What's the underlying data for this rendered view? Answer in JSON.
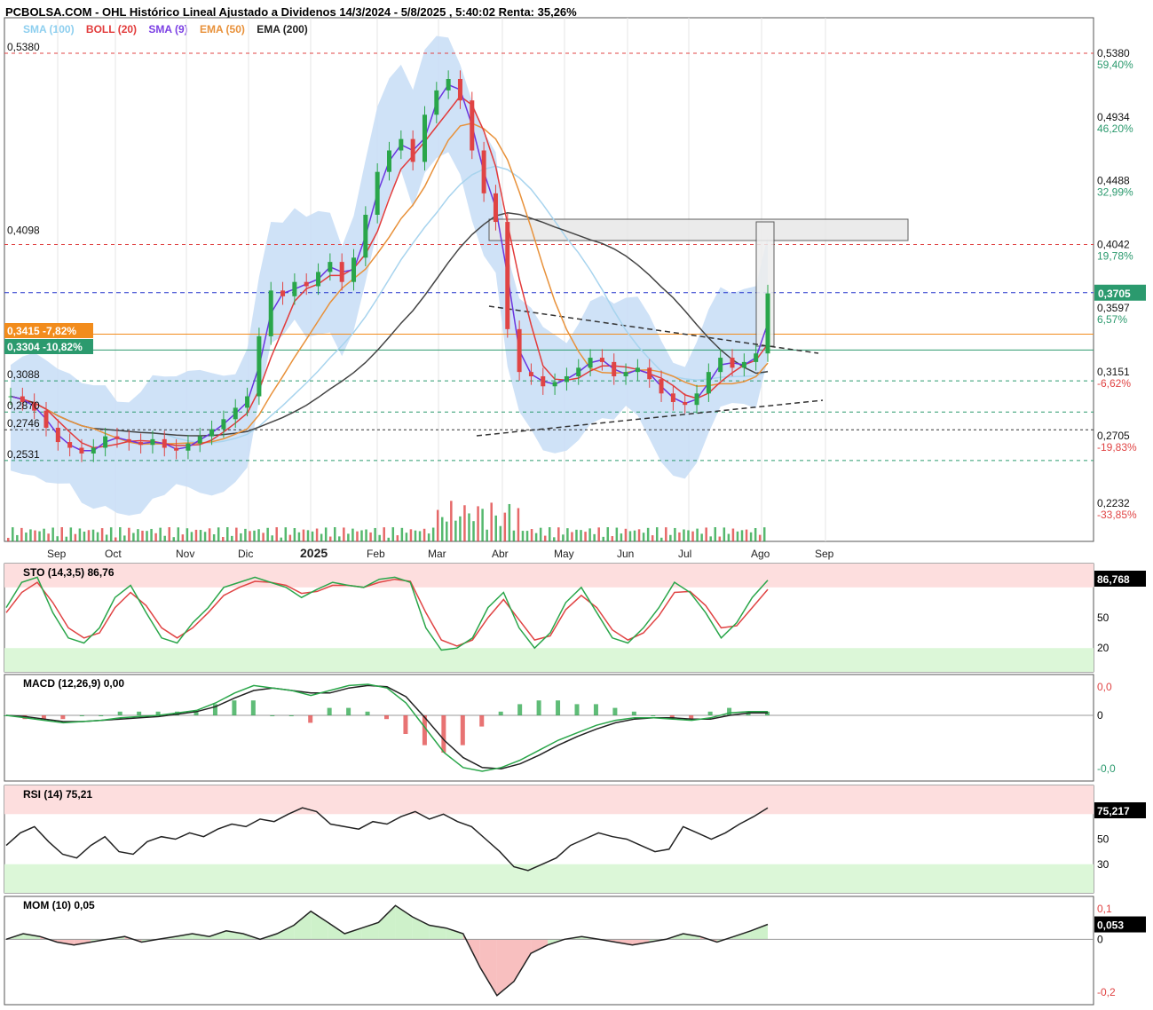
{
  "header": {
    "title": "PCBOLSA.COM - OHL Histórico Lineal Ajustado a Dividenos 14/3/2024 - 5/8/2025 , 5:40:02 Renta: 35,26%",
    "legend": [
      {
        "label": "SMA (100)",
        "color": "#8ecfef"
      },
      {
        "label": "BOLL (20)",
        "color": "#e23b3b"
      },
      {
        "label": "SMA (9)",
        "color": "#7b3fe4"
      },
      {
        "label": "EMA (50)",
        "color": "#e8913a"
      },
      {
        "label": "EMA (200)",
        "color": "#222222"
      }
    ]
  },
  "colors": {
    "up": "#2aa64a",
    "down": "#e04444",
    "boll_band": "#c7ddf6",
    "sma100": "#a8d4ee",
    "boll_mid": "#e23b3b",
    "sma9": "#6a35e0",
    "ema50": "#e8913a",
    "ema200": "#444444",
    "green_line": "#2b9a6e",
    "blue_dash": "#2233cc",
    "red_dash": "#e04444"
  },
  "chart_data": [
    {
      "type": "line",
      "name": "price",
      "x_ticks": [
        "Sep",
        "Oct",
        "Nov",
        "Dic",
        "2025",
        "Feb",
        "Mar",
        "Abr",
        "May",
        "Jun",
        "Jul",
        "Ago",
        "Sep"
      ],
      "right_axis": [
        {
          "value": "0,5380",
          "pct": "59,40%",
          "pct_color": "#2b9a6e"
        },
        {
          "value": "0,4934",
          "pct": "46,20%",
          "pct_color": "#2b9a6e"
        },
        {
          "value": "0,4488",
          "pct": "32,99%",
          "pct_color": "#2b9a6e"
        },
        {
          "value": "0,4042",
          "pct": "19,78%",
          "pct_color": "#2b9a6e"
        },
        {
          "value": "0,3597",
          "pct": "6,57%",
          "pct_color": "#2b9a6e"
        },
        {
          "value": "0,3151",
          "pct": "-6,62%",
          "pct_color": "#e04444"
        },
        {
          "value": "0,2705",
          "pct": "-19,83%",
          "pct_color": "#e04444"
        },
        {
          "value": "0,2232",
          "pct": "-33,85%",
          "pct_color": "#e04444"
        }
      ],
      "left_levels": [
        "0,5380",
        "0,4098",
        "0,3088",
        "0,2870",
        "0,2746",
        "0,2531"
      ],
      "last_price": "0,3705",
      "badges": [
        {
          "text": "0,3415  -7,82%",
          "color": "#f28c1c"
        },
        {
          "text": "0,3304  -10,82%",
          "color": "#2b9a6e"
        }
      ],
      "closes": [
        0.298,
        0.294,
        0.288,
        0.276,
        0.266,
        0.262,
        0.258,
        0.262,
        0.27,
        0.268,
        0.266,
        0.264,
        0.268,
        0.262,
        0.26,
        0.265,
        0.27,
        0.275,
        0.282,
        0.29,
        0.298,
        0.34,
        0.372,
        0.368,
        0.378,
        0.375,
        0.385,
        0.392,
        0.378,
        0.395,
        0.425,
        0.455,
        0.47,
        0.478,
        0.462,
        0.495,
        0.512,
        0.52,
        0.505,
        0.47,
        0.44,
        0.42,
        0.345,
        0.315,
        0.312,
        0.305,
        0.308,
        0.312,
        0.318,
        0.325,
        0.322,
        0.312,
        0.315,
        0.318,
        0.31,
        0.3,
        0.294,
        0.292,
        0.3,
        0.315,
        0.325,
        0.318,
        0.322,
        0.328,
        0.37
      ]
    },
    {
      "type": "line",
      "name": "STO (14,3,5)",
      "label": "STO (14,3,5)",
      "value": "86,76",
      "badge": "86,768",
      "ticks": [
        "50",
        "20"
      ],
      "levels": [
        20,
        80
      ],
      "k": [
        60,
        85,
        90,
        55,
        30,
        25,
        40,
        70,
        82,
        55,
        30,
        25,
        45,
        60,
        80,
        85,
        90,
        85,
        80,
        70,
        78,
        85,
        82,
        80,
        88,
        90,
        85,
        40,
        18,
        20,
        30,
        60,
        75,
        40,
        20,
        35,
        65,
        80,
        55,
        30,
        25,
        40,
        60,
        85,
        75,
        55,
        30,
        45,
        70,
        87
      ],
      "d": [
        55,
        75,
        85,
        65,
        40,
        30,
        35,
        60,
        75,
        62,
        40,
        30,
        40,
        55,
        72,
        80,
        86,
        85,
        82,
        74,
        76,
        82,
        82,
        80,
        85,
        88,
        86,
        55,
        28,
        22,
        28,
        50,
        68,
        48,
        28,
        32,
        58,
        72,
        60,
        38,
        28,
        35,
        52,
        75,
        76,
        62,
        40,
        42,
        60,
        78
      ]
    },
    {
      "type": "line",
      "name": "MACD (12,26,9)",
      "label": "MACD (12,26,9)",
      "value": "0,00",
      "ticks": [
        "0,0",
        "0",
        "-0,0"
      ],
      "macd": [
        0.0,
        -0.002,
        -0.004,
        -0.006,
        -0.005,
        -0.004,
        -0.002,
        -0.001,
        0.0,
        0.002,
        0.004,
        0.01,
        0.018,
        0.024,
        0.022,
        0.02,
        0.016,
        0.02,
        0.024,
        0.025,
        0.022,
        0.01,
        -0.01,
        -0.03,
        -0.042,
        -0.045,
        -0.042,
        -0.036,
        -0.028,
        -0.02,
        -0.014,
        -0.008,
        -0.004,
        -0.002,
        -0.002,
        -0.003,
        -0.004,
        -0.002,
        0.002,
        0.003,
        0.003
      ],
      "signal": [
        0.0,
        -0.001,
        -0.003,
        -0.005,
        -0.005,
        -0.004,
        -0.003,
        -0.002,
        -0.001,
        0.001,
        0.003,
        0.007,
        0.014,
        0.02,
        0.022,
        0.02,
        0.018,
        0.018,
        0.022,
        0.024,
        0.023,
        0.015,
        -0.002,
        -0.02,
        -0.034,
        -0.042,
        -0.043,
        -0.039,
        -0.032,
        -0.024,
        -0.017,
        -0.011,
        -0.006,
        -0.003,
        -0.002,
        -0.002,
        -0.003,
        -0.003,
        0.0,
        0.002,
        0.002
      ]
    },
    {
      "type": "line",
      "name": "RSI (14)",
      "label": "RSI (14)",
      "value": "75,21",
      "badge": "75,217",
      "ticks": [
        "50",
        "30"
      ],
      "levels": [
        30,
        70
      ],
      "values": [
        45,
        55,
        60,
        48,
        38,
        35,
        45,
        52,
        40,
        38,
        48,
        52,
        50,
        55,
        52,
        58,
        62,
        60,
        66,
        64,
        70,
        75,
        72,
        62,
        60,
        58,
        64,
        62,
        68,
        72,
        66,
        70,
        64,
        60,
        50,
        40,
        28,
        25,
        30,
        35,
        45,
        50,
        55,
        52,
        50,
        45,
        40,
        42,
        60,
        55,
        50,
        55,
        62,
        68,
        75
      ]
    },
    {
      "type": "line",
      "name": "MOM (10)",
      "label": "MOM (10)",
      "value": "0,05",
      "badge": "0,053",
      "ticks": [
        "0,1",
        "0",
        "-0,2"
      ],
      "values": [
        0.0,
        0.02,
        0.01,
        -0.01,
        -0.02,
        -0.01,
        0.0,
        0.01,
        -0.01,
        0.0,
        0.01,
        0.02,
        0.01,
        0.03,
        0.02,
        0.0,
        0.02,
        0.05,
        0.1,
        0.06,
        0.02,
        0.04,
        0.06,
        0.12,
        0.08,
        0.05,
        0.04,
        0.02,
        -0.1,
        -0.2,
        -0.15,
        -0.05,
        -0.02,
        0.0,
        0.01,
        0.0,
        -0.01,
        -0.02,
        -0.01,
        0.0,
        0.02,
        0.01,
        -0.01,
        0.01,
        0.03,
        0.053
      ]
    }
  ]
}
